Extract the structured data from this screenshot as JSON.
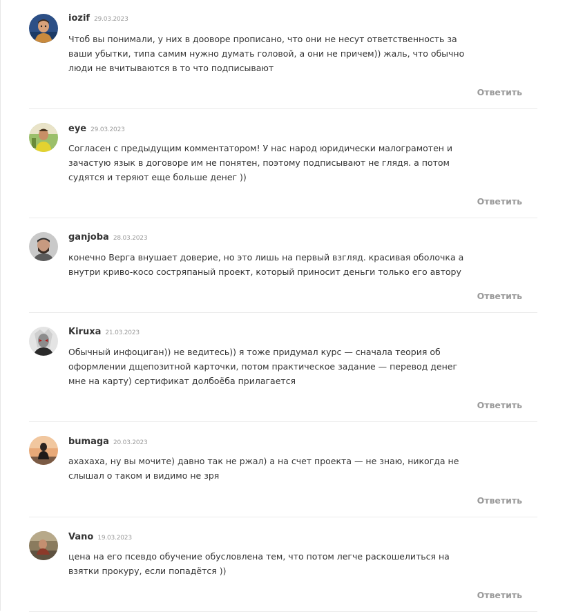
{
  "comments": [
    {
      "author": "iozif",
      "date": "29.03.2023",
      "text": "Чтоб вы понимали, у них в дооворе прописано, что они не несут ответственность за ваши убытки, типа самим нужно думать головой, а они не причем)) жаль, что обычно люди не вчитываются в то что подписывают",
      "reply_label": "Ответить"
    },
    {
      "author": "eye",
      "date": "29.03.2023",
      "text": "Согласен с предыдущим комментатором! У нас народ юридически малограмотен и зачастую язык в договоре им не понятен, поэтому подписывают не глядя. а потом судятся и теряют еще больше денег ))",
      "reply_label": "Ответить"
    },
    {
      "author": "ganjoba",
      "date": "28.03.2023",
      "text": "конечно Верга внушает доверие, но это лишь на первый взгляд. красивая оболочка а внутри криво-косо состряпаный проект, который приносит деньги только его автору",
      "reply_label": "Ответить"
    },
    {
      "author": "Kiruxa",
      "date": "21.03.2023",
      "text": "Обычный инфоциган)) не ведитесь)) я тоже придумал курс — сначала теория об оформлении дщепозитной карточки, потом практическое задание — перевод денег мне на карту) сертификат долбоёба прилагается",
      "reply_label": "Ответить"
    },
    {
      "author": "bumaga",
      "date": "20.03.2023",
      "text": "ахахаха, ну вы мочите) давно так не ржал) а на счет проекта — не знаю, никогда не слышал о таком и видимо не зря",
      "reply_label": "Ответить"
    },
    {
      "author": "Vano",
      "date": "19.03.2023",
      "text": "цена на его псевдо обучение обусловлена тем, что потом легче раскошелиться на взятки прокуру, если попадётся ))",
      "reply_label": "Ответить"
    }
  ]
}
